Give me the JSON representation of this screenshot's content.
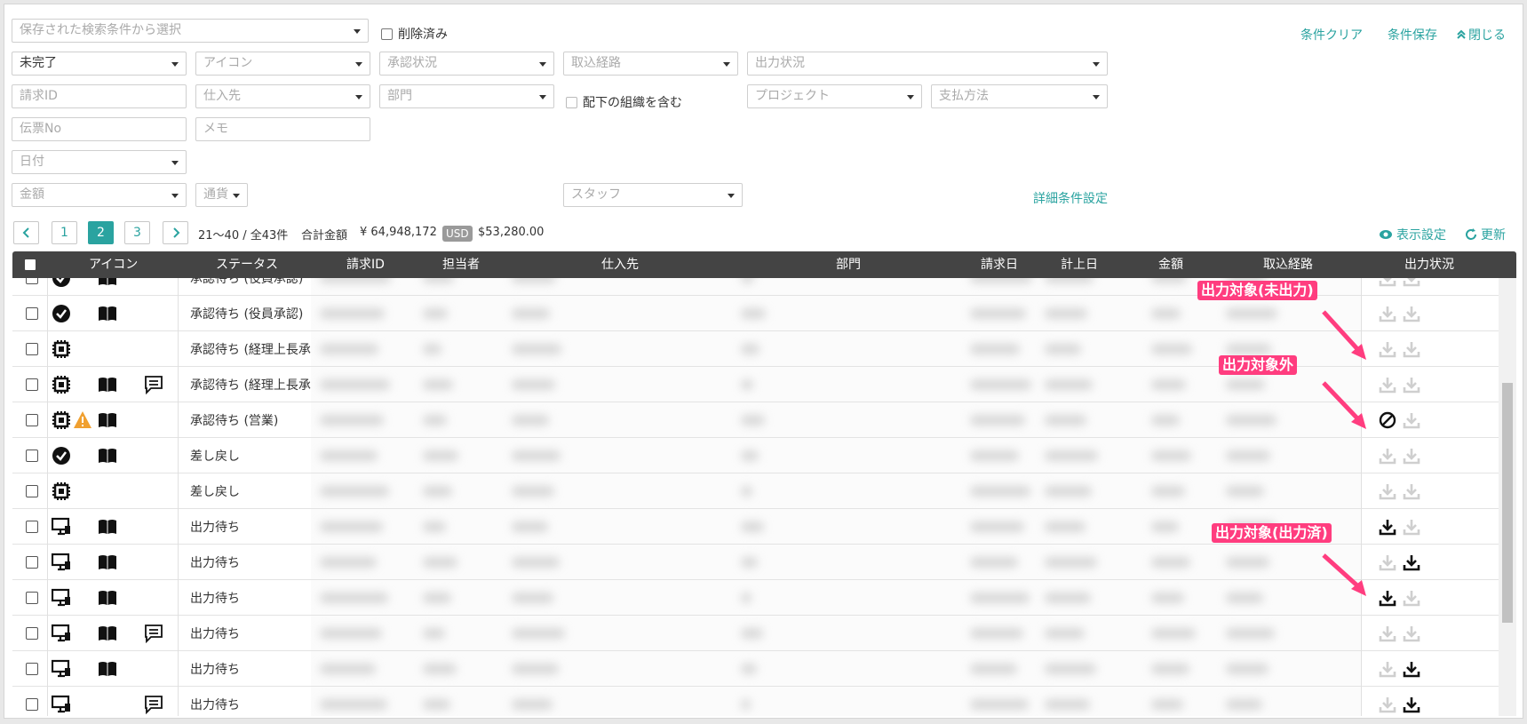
{
  "filters": {
    "saved_search_placeholder": "保存された検索条件から選択",
    "deleted_label": "削除済み",
    "clear_link": "条件クリア",
    "save_link": "条件保存",
    "close_link": "閉じる",
    "status_value": "未完了",
    "icon_placeholder": "アイコン",
    "approval_placeholder": "承認状況",
    "import_placeholder": "取込経路",
    "output_placeholder": "出力状況",
    "invoice_id_placeholder": "請求ID",
    "supplier_placeholder": "仕入先",
    "dept_placeholder": "部門",
    "include_sub_label": "配下の組織を含む",
    "project_placeholder": "プロジェクト",
    "payment_placeholder": "支払方法",
    "slip_placeholder": "伝票No",
    "memo_placeholder": "メモ",
    "date_placeholder": "日付",
    "amount_placeholder": "金額",
    "currency_placeholder": "通貨",
    "staff_placeholder": "スタッフ",
    "detail_link": "詳細条件設定"
  },
  "pager": {
    "pages": [
      "1",
      "2",
      "3"
    ],
    "current": "2",
    "range_text": "21〜40 / 全43件",
    "total_label": "合計金額",
    "total_jpy": "¥ 64,948,172",
    "usd_badge": "USD",
    "total_usd": "$53,280.00",
    "display_settings": "表示設定",
    "refresh": "更新"
  },
  "table": {
    "headers": {
      "icon": "アイコン",
      "status": "ステータス",
      "invoice_id": "請求ID",
      "owner": "担当者",
      "supplier": "仕入先",
      "dept": "部門",
      "invoice_date": "請求日",
      "posting_date": "計上日",
      "amount": "金額",
      "import_route": "取込経路",
      "output_status": "出力状況"
    },
    "rows": [
      {
        "status": "承認待ち (役員承認)",
        "icons": [
          "check-circle",
          "book"
        ],
        "out": [
          "gray",
          "gray"
        ]
      },
      {
        "status": "承認待ち (役員承認)",
        "icons": [
          "check-circle",
          "book"
        ],
        "out": [
          "gray",
          "gray"
        ]
      },
      {
        "status": "承認待ち (経理上長承認)",
        "icons": [
          "chip"
        ],
        "out": [
          "gray",
          "gray"
        ]
      },
      {
        "status": "承認待ち (経理上長承認)",
        "icons": [
          "chip",
          "book",
          "comment"
        ],
        "out": [
          "gray",
          "gray"
        ]
      },
      {
        "status": "承認待ち (営業)",
        "icons": [
          "chip",
          "warning",
          "book"
        ],
        "out": [
          "ban",
          "gray"
        ]
      },
      {
        "status": "差し戻し",
        "icons": [
          "check-circle",
          "book"
        ],
        "out": [
          "gray",
          "gray"
        ]
      },
      {
        "status": "差し戻し",
        "icons": [
          "chip"
        ],
        "out": [
          "gray",
          "gray"
        ]
      },
      {
        "status": "出力待ち",
        "icons": [
          "monitor",
          "book"
        ],
        "out": [
          "black",
          "gray"
        ]
      },
      {
        "status": "出力待ち",
        "icons": [
          "monitor",
          "book"
        ],
        "out": [
          "gray",
          "black"
        ]
      },
      {
        "status": "出力待ち",
        "icons": [
          "monitor",
          "book"
        ],
        "out": [
          "black",
          "gray"
        ]
      },
      {
        "status": "出力待ち",
        "icons": [
          "monitor",
          "book",
          "comment"
        ],
        "out": [
          "gray",
          "gray"
        ]
      },
      {
        "status": "出力待ち",
        "icons": [
          "monitor",
          "book"
        ],
        "out": [
          "gray",
          "black"
        ]
      },
      {
        "status": "出力待ち",
        "icons": [
          "monitor",
          "comment"
        ],
        "out": [
          "gray",
          "black"
        ]
      }
    ]
  },
  "callouts": {
    "not_output": "出力対象(未出力)",
    "excluded": "出力対象外",
    "output_done": "出力対象(出力済)"
  },
  "colors": {
    "accent": "#2aa3a0",
    "header_bg": "#444444",
    "callout": "#ff3d7f"
  }
}
